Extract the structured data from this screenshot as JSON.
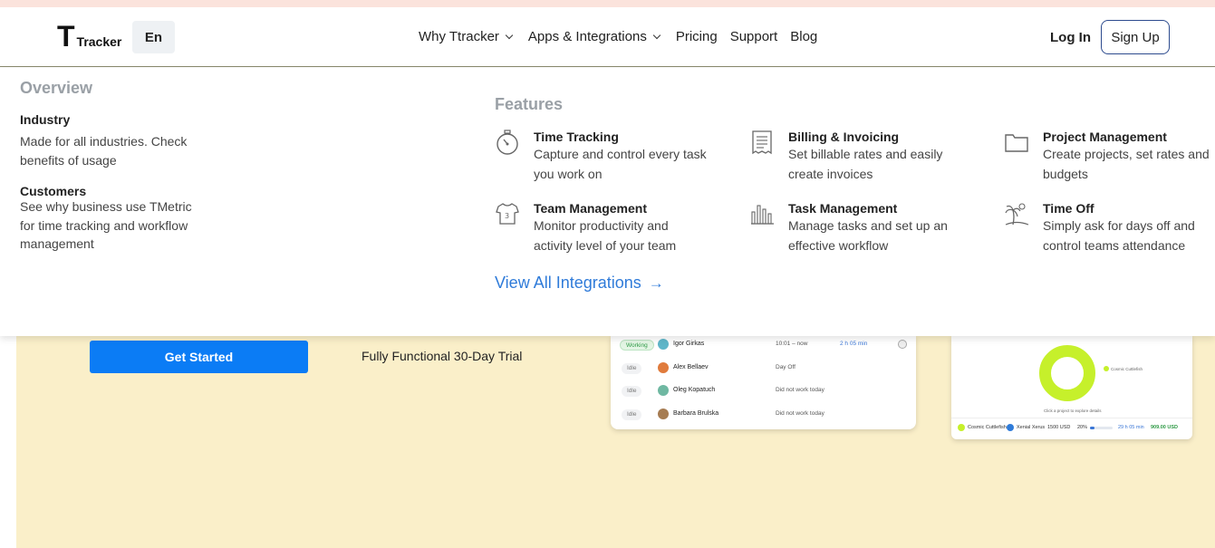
{
  "header": {
    "logo_letter": "T",
    "logo_word": "Tracker",
    "language": "En",
    "nav": [
      {
        "label": "Why Ttracker",
        "has_dropdown": true
      },
      {
        "label": "Apps & Integrations",
        "has_dropdown": true
      },
      {
        "label": "Pricing",
        "has_dropdown": false
      },
      {
        "label": "Support",
        "has_dropdown": false
      },
      {
        "label": "Blog",
        "has_dropdown": false
      }
    ],
    "login": "Log In",
    "signup": "Sign Up"
  },
  "dropdown": {
    "overview": {
      "title": "Overview",
      "items": [
        {
          "title": "Industry",
          "text": "Made for all industries. Check benefits of usage"
        },
        {
          "title": "Customers",
          "text": "See why business use TMetric for time tracking and workflow management"
        }
      ]
    },
    "features": {
      "title": "Features",
      "items": [
        {
          "name": "Time Tracking",
          "desc": "Capture and control every task you work on",
          "icon": "stopwatch-icon"
        },
        {
          "name": "Billing & Invoicing",
          "desc": "Set billable rates and easily create invoices",
          "icon": "invoice-icon"
        },
        {
          "name": "Project Management",
          "desc": "Create projects, set rates and budgets",
          "icon": "folder-icon"
        },
        {
          "name": "Team Management",
          "desc": "Monitor productivity and activity level of your team",
          "icon": "jersey-icon"
        },
        {
          "name": "Task Management",
          "desc": "Manage tasks and set up an effective workflow",
          "icon": "bar-chart-icon"
        },
        {
          "name": "Time Off",
          "desc": "Simply ask for days off and control teams attendance",
          "icon": "palm-tree-icon"
        }
      ]
    },
    "view_all": "View All Integrations",
    "view_all_arrow": "→"
  },
  "hero": {
    "cta": "Get Started",
    "trial": "Fully Functional 30-Day Trial"
  },
  "team_card": {
    "rows": [
      {
        "status": "Working",
        "name": "Igor Girkas",
        "time": "10:01  –   now",
        "duration": "2 h 05 min",
        "avatar_color": "#5fb6c9"
      },
      {
        "status": "Idle",
        "name": "Alex Bellaev",
        "time": "Day Off",
        "duration": "",
        "avatar_color": "#e07b3c"
      },
      {
        "status": "Idle",
        "name": "Oleg Kopatuch",
        "time": "Did not work today",
        "duration": "",
        "avatar_color": "#6fb8a2"
      },
      {
        "status": "Idle",
        "name": "Barbara Brulska",
        "time": "Did not work today",
        "duration": "",
        "avatar_color": "#a67c52"
      }
    ]
  },
  "project_card": {
    "legend": "Cosmic Cuttlefish",
    "caption": "Click a project to explore details",
    "footer": {
      "project_a": "Cosmic Cuttlefish",
      "project_b": "Xenial Xerus",
      "budget": "1500 USD",
      "percent": "20%",
      "progress": 0.2,
      "duration": "29 h 05 min",
      "amount": "909.00 USD"
    },
    "colors": {
      "accent_lime": "#c6f02b",
      "accent_blue": "#2f7bd9"
    }
  }
}
